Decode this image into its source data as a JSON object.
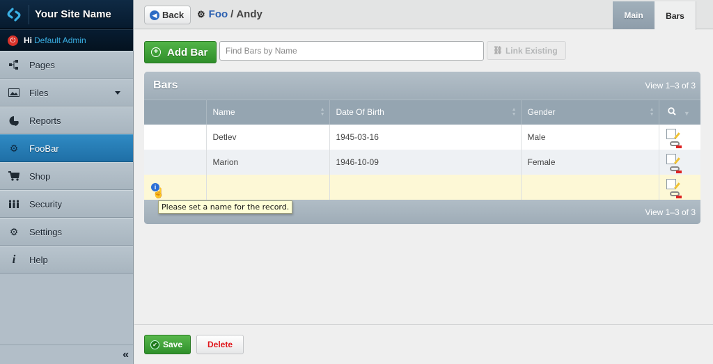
{
  "brand": {
    "site_name": "Your Site Name",
    "logo_icon": "site-logo-icon"
  },
  "user": {
    "greeting": "Hi",
    "name": "Default Admin",
    "power_icon": "power-icon"
  },
  "sidebar": {
    "items": [
      {
        "label": "Pages",
        "icon": "sitemap-icon",
        "glyph": "⋮"
      },
      {
        "label": "Files",
        "icon": "image-icon",
        "glyph": "▭",
        "has_dropdown": true
      },
      {
        "label": "Reports",
        "icon": "pie-chart-icon",
        "glyph": "◕"
      },
      {
        "label": "FooBar",
        "icon": "gears-icon",
        "glyph": "⚙",
        "active": true
      },
      {
        "label": "Shop",
        "icon": "cart-icon",
        "glyph": "🛒"
      },
      {
        "label": "Security",
        "icon": "users-icon",
        "glyph": "👥"
      },
      {
        "label": "Settings",
        "icon": "gears-icon",
        "glyph": "⚙"
      },
      {
        "label": "Help",
        "icon": "info-icon",
        "glyph": "𝒊"
      }
    ],
    "collapse_label": "«"
  },
  "topbar": {
    "back_label": "Back",
    "breadcrumb": {
      "parent": "Foo",
      "separator": "/",
      "current": "Andy"
    },
    "tabs": [
      {
        "label": "Main"
      },
      {
        "label": "Bars",
        "active": true
      }
    ]
  },
  "toolbar": {
    "add_label": "Add Bar",
    "search_placeholder": "Find Bars by Name",
    "search_value": "",
    "link_existing_label": "Link Existing"
  },
  "grid": {
    "title": "Bars",
    "view_info": "View 1–3 of 3",
    "columns": [
      "",
      "Name",
      "Date Of Birth",
      "Gender",
      ""
    ],
    "rows": [
      {
        "name": "Detlev",
        "dob": "1945-03-16",
        "gender": "Male"
      },
      {
        "name": "Marion",
        "dob": "1946-10-09",
        "gender": "Female"
      },
      {
        "name": "",
        "dob": "",
        "gender": "",
        "has_error": true
      }
    ],
    "footer_view_info": "View 1–3 of 3"
  },
  "tooltip": {
    "text": "Please set a name for the record."
  },
  "actions": {
    "save_label": "Save",
    "delete_label": "Delete"
  },
  "colors": {
    "accent_blue": "#2a7fbc",
    "save_green": "#3a9f33",
    "delete_red": "#e0161b",
    "error_row": "#fdf8d6"
  }
}
